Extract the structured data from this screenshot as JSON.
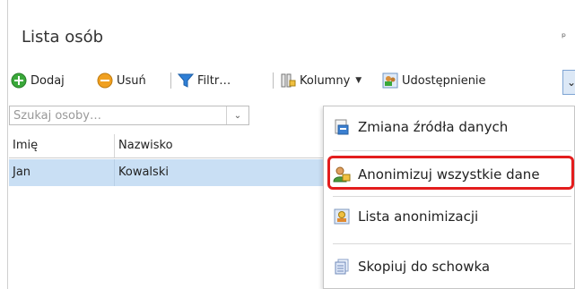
{
  "panel": {
    "title": "Lista osób",
    "pin_glyph": "⊥"
  },
  "toolbar": {
    "add_label": "Dodaj",
    "remove_label": "Usuń",
    "filter_label": "Filtr…",
    "columns_label": "Kolumny",
    "share_label": "Udostępnienie",
    "more_glyph": "❯"
  },
  "search": {
    "placeholder": "Szukaj osoby…"
  },
  "grid": {
    "headers": [
      "Imię",
      "Nazwisko"
    ],
    "rows": [
      [
        "Jan",
        "Kowalski"
      ]
    ]
  },
  "context_menu": {
    "items": [
      "Zmiana źródła danych",
      "Anonimizuj wszystkie dane",
      "Lista anonimizacji",
      "Skopiuj do schowka"
    ]
  },
  "colors": {
    "accent_selection": "#c9dff4",
    "highlight_red": "#e31d1d",
    "add_green": "#3aa83a",
    "remove_orange": "#f0a020",
    "filter_blue": "#2f7fd6"
  }
}
